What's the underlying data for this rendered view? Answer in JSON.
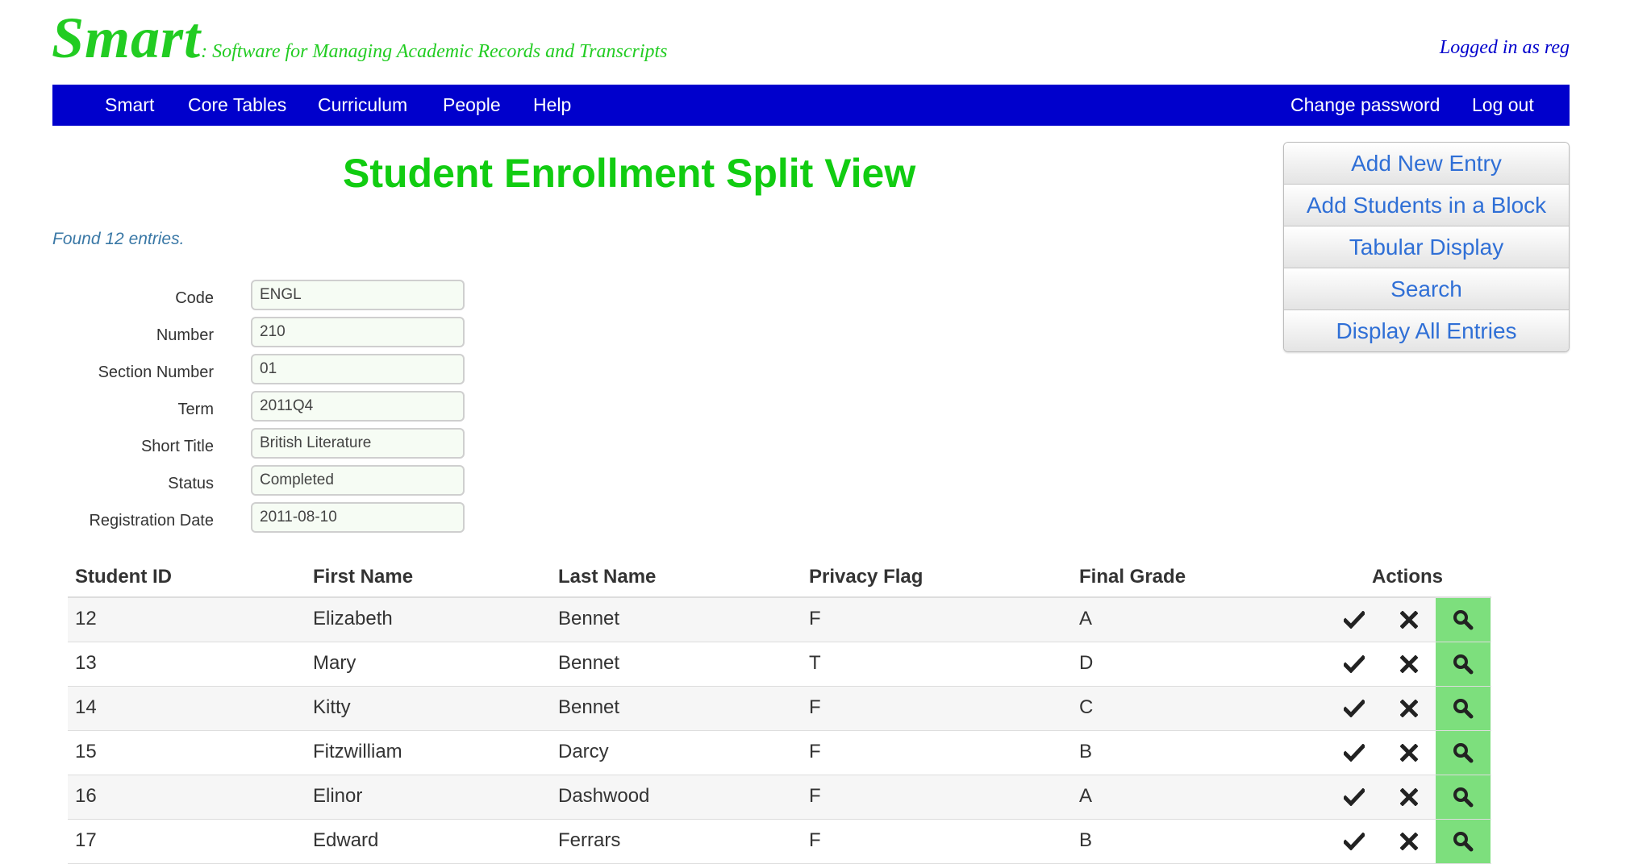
{
  "header": {
    "brand": "Smart",
    "tagline": ": Software for Managing Academic Records and Transcripts",
    "logged_in": "Logged in as reg"
  },
  "nav": {
    "left": [
      "Smart",
      "Core Tables",
      "Curriculum",
      "People",
      "Help"
    ],
    "right": [
      "Change password",
      "Log out"
    ]
  },
  "page": {
    "title": "Student Enrollment Split View",
    "found": "Found 12 entries."
  },
  "side_buttons": [
    "Add New Entry",
    "Add Students in a Block",
    "Tabular Display",
    "Search",
    "Display All Entries"
  ],
  "form": {
    "fields": [
      {
        "label": "Code",
        "value": "ENGL"
      },
      {
        "label": "Number",
        "value": "210"
      },
      {
        "label": "Section Number",
        "value": "01"
      },
      {
        "label": "Term",
        "value": "2011Q4"
      },
      {
        "label": "Short Title",
        "value": "British Literature"
      },
      {
        "label": "Status",
        "value": "Completed"
      },
      {
        "label": "Registration Date",
        "value": "2011-08-10"
      }
    ]
  },
  "table": {
    "headers": [
      "Student ID",
      "First Name",
      "Last Name",
      "Privacy Flag",
      "Final Grade",
      "Actions"
    ],
    "rows": [
      [
        "12",
        "Elizabeth",
        "Bennet",
        "F",
        "A"
      ],
      [
        "13",
        "Mary",
        "Bennet",
        "T",
        "D"
      ],
      [
        "14",
        "Kitty",
        "Bennet",
        "F",
        "C"
      ],
      [
        "15",
        "Fitzwilliam",
        "Darcy",
        "F",
        "B"
      ],
      [
        "16",
        "Elinor",
        "Dashwood",
        "F",
        "A"
      ],
      [
        "17",
        "Edward",
        "Ferrars",
        "F",
        "B"
      ]
    ]
  },
  "colors": {
    "brand_green": "#22cc22",
    "nav_blue": "#0000cc",
    "link_blue": "#2f6fd6",
    "view_green": "#7ddf7d"
  },
  "icons": {
    "accept": "check-icon",
    "reject": "close-icon",
    "view": "search-icon"
  }
}
